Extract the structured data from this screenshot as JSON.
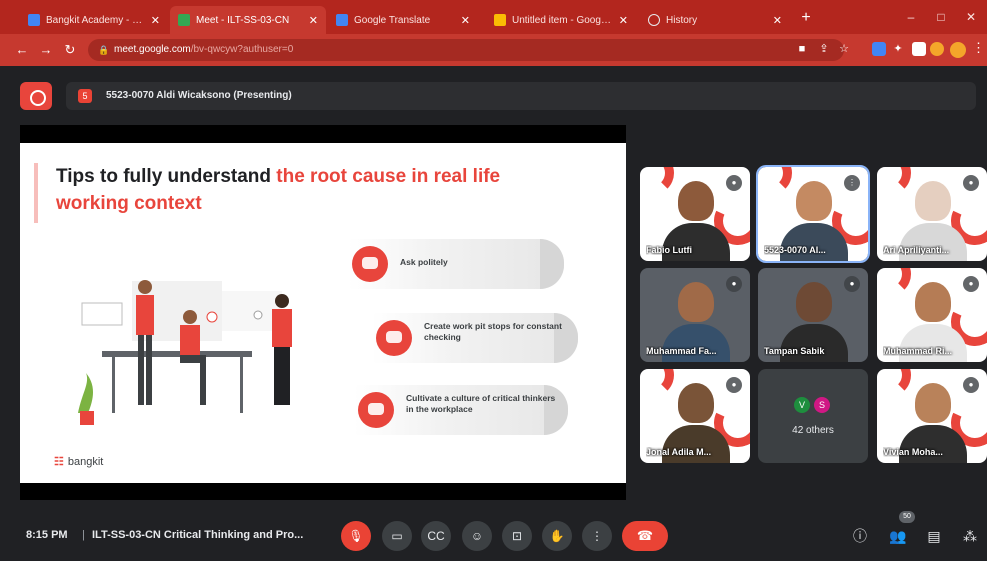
{
  "browser": {
    "tabs": [
      {
        "label": "Bangkit Academy - Calo",
        "favicon_color": "#4285f4",
        "active": false
      },
      {
        "label": "Meet - ILT-SS-03-CN",
        "favicon_color": "#34a853",
        "active": true
      },
      {
        "label": "Google Translate",
        "favicon_color": "#4285f4",
        "active": false
      },
      {
        "label": "Untitled item - Google fo",
        "favicon_color": "#fbbc04",
        "active": false
      },
      {
        "label": "History",
        "favicon_color": "#e8eaed",
        "active": false
      }
    ],
    "new_tab_label": "+",
    "window_controls": {
      "minimize": "–",
      "maximize": "□",
      "close": "✕"
    },
    "url_host": "meet.google.com",
    "url_path": "/bv-qwcyw?authuser=0",
    "theme_color": "#c6392f"
  },
  "meet": {
    "presenter_chip": "5523-0070 Aldi Wicaksono (Presenting)",
    "presenter_chip_number": "5"
  },
  "slide": {
    "title_plain": "Tips to fully understand ",
    "title_highlight": "the root cause in real life working context",
    "tips": [
      "Ask politely",
      "Create work pit stops for constant checking",
      "Cultivate a culture of critical thinkers in the workplace"
    ],
    "brand_mark": "☷",
    "brand_name": "bangkit",
    "accent_color": "#e8453c"
  },
  "participants": [
    {
      "name": "Fabio Lutfi",
      "bg": "logo",
      "tone": "#8d5a3b",
      "shirt": "#2d2d2d",
      "speaking": false
    },
    {
      "name": "5523-0070 Al...",
      "bg": "logo",
      "tone": "#c48a62",
      "shirt": "#3b4a5a",
      "speaking": true
    },
    {
      "name": "Ari Apriliyanti...",
      "bg": "logo",
      "tone": "#e5cfc0",
      "shirt": "#d8d8d8",
      "speaking": false
    },
    {
      "name": "Muhammad Fa...",
      "bg": "cam",
      "tone": "#a06a48",
      "shirt": "#36506b",
      "speaking": false
    },
    {
      "name": "Tampan Sabik",
      "bg": "cam",
      "tone": "#6e4a35",
      "shirt": "#2a2a2a",
      "speaking": false
    },
    {
      "name": "Muhammad Ri...",
      "bg": "logo",
      "tone": "#b57c55",
      "shirt": "#e7e7e7",
      "speaking": false
    },
    {
      "name": "Jonal Adila M...",
      "bg": "logo",
      "tone": "#7a5438",
      "shirt": "#4a3b2a",
      "speaking": false
    },
    {
      "name": "Vivian Moha...",
      "bg": "logo",
      "tone": "#b9825a",
      "shirt": "#2e2e2e",
      "speaking": false
    }
  ],
  "others_tile": {
    "label": "42 others",
    "avatars": [
      {
        "letter": "V",
        "color": "#1e8e3e"
      },
      {
        "letter": "S",
        "color": "#d01884"
      }
    ]
  },
  "bottom": {
    "clock": "8:15 PM",
    "separator": "|",
    "meeting_title": "ILT-SS-03-CN Critical Thinking and Pro...",
    "people_count": "50"
  },
  "icons": {
    "mic_off": "mic-off-icon",
    "camera": "camera-icon",
    "captions": "captions-icon",
    "emoji": "emoji-icon",
    "present": "present-icon",
    "raise_hand": "raise-hand-icon",
    "more": "more-options-icon",
    "end_call": "end-call-icon",
    "info": "info-icon",
    "people": "people-icon",
    "chat": "chat-icon",
    "activities": "activities-icon"
  }
}
